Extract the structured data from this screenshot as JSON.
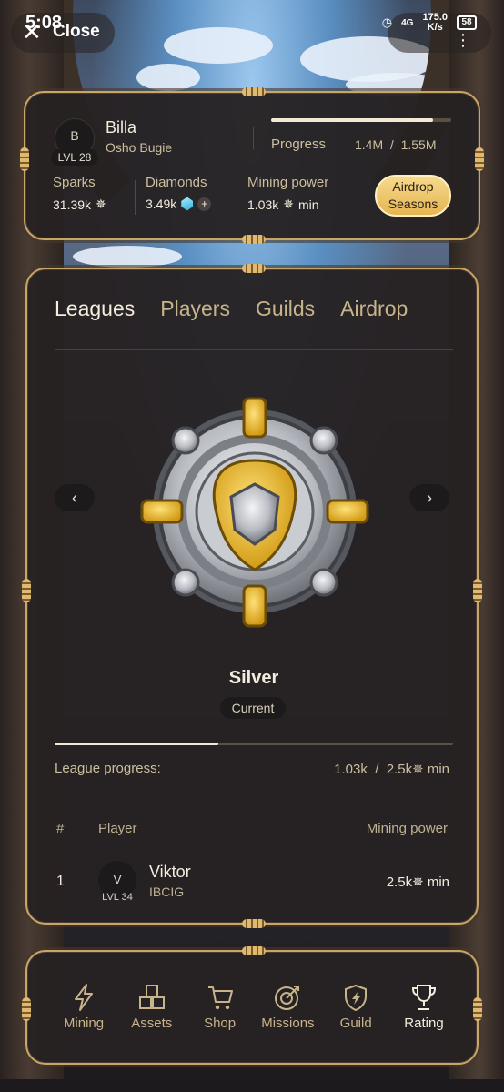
{
  "status_bar": {
    "time": "5:08",
    "network": "4G",
    "speed_value": "175.0",
    "speed_unit": "K/s",
    "battery": "58"
  },
  "header": {
    "close_label": "Close",
    "user": {
      "avatar_letter": "B",
      "level": "LVL 28",
      "name": "Billa",
      "subtitle": "Osho Bugie"
    },
    "progress": {
      "label": "Progress",
      "current": "1.4M",
      "total": "1.55M",
      "fraction": 0.9
    },
    "stats": {
      "sparks": {
        "label": "Sparks",
        "value": "31.39k"
      },
      "diamonds": {
        "label": "Diamonds",
        "value": "3.49k"
      },
      "mining_power": {
        "label": "Mining power",
        "value": "1.03k",
        "unit": "min"
      }
    },
    "airdrop_button": {
      "line1": "Airdrop",
      "line2": "Seasons"
    }
  },
  "main": {
    "tabs": [
      {
        "label": "Leagues",
        "active": true
      },
      {
        "label": "Players",
        "active": false
      },
      {
        "label": "Guilds",
        "active": false
      },
      {
        "label": "Airdrop",
        "active": false
      }
    ],
    "league": {
      "name": "Silver",
      "status": "Current"
    },
    "league_progress": {
      "label": "League progress:",
      "current": "1.03k",
      "target": "2.5k",
      "unit": "min",
      "fraction": 0.41
    },
    "table": {
      "headers": {
        "rank": "#",
        "player": "Player",
        "power": "Mining power"
      },
      "rows": [
        {
          "rank": "1",
          "avatar_letter": "V",
          "level": "LVL 34",
          "name": "Viktor",
          "guild": "IBCIG",
          "power": "2.5k",
          "unit": "min"
        }
      ]
    }
  },
  "bottom_nav": [
    {
      "label": "Mining",
      "icon": "lightning-icon",
      "active": false
    },
    {
      "label": "Assets",
      "icon": "cubes-icon",
      "active": false
    },
    {
      "label": "Shop",
      "icon": "cart-icon",
      "active": false
    },
    {
      "label": "Missions",
      "icon": "target-icon",
      "active": false
    },
    {
      "label": "Guild",
      "icon": "shield-icon",
      "active": false
    },
    {
      "label": "Rating",
      "icon": "trophy-icon",
      "active": true
    }
  ],
  "colors": {
    "gold": "#c9a567",
    "panel": "#262122",
    "text": "#f4ecdc",
    "muted": "#cbbf9e",
    "button": "#e5b552"
  }
}
